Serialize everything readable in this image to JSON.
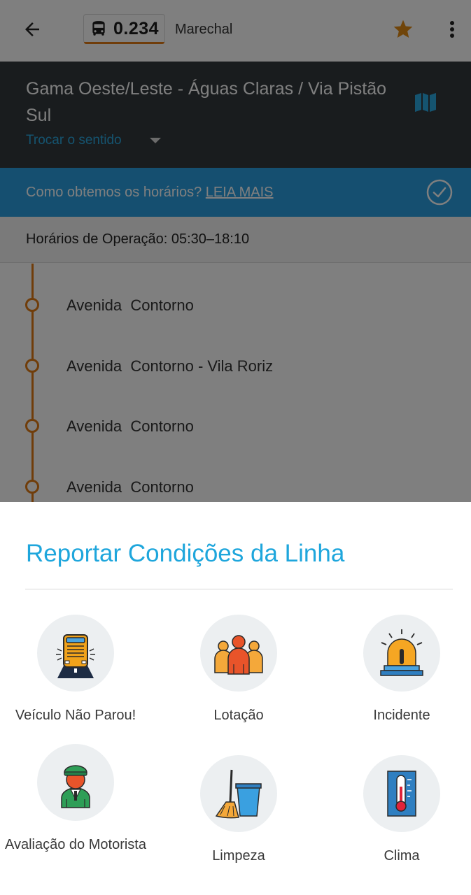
{
  "topbar": {
    "line_number": "0.234",
    "operator": "Marechal",
    "icons": {
      "back": "arrow-left",
      "bus": "bus",
      "favorite": "star",
      "more": "more-vertical"
    },
    "colors": {
      "favorite_star": "#e08a14",
      "line_underline": "#e07b14"
    }
  },
  "route": {
    "title": "Gama Oeste/Leste - Águas Claras / Via Pistão Sul",
    "swap_direction": "Trocar o sentido",
    "icons": {
      "map": "map",
      "caret": "caret-down"
    },
    "colors": {
      "header_bg": "#32383d",
      "link": "#2aa8e0"
    }
  },
  "info_bar": {
    "question": "Como obtemos os horários?",
    "link": "LEIA MAIS",
    "icon": "check-circle",
    "color": "#2a9fe0"
  },
  "operation": {
    "hours_text": "Horários de Operação: 05:30–18:10"
  },
  "stops": [
    {
      "name": "Avenida  Contorno"
    },
    {
      "name": "Avenida  Contorno - Vila Roriz"
    },
    {
      "name": "Avenida  Contorno"
    },
    {
      "name": "Avenida  Contorno"
    }
  ],
  "sheet": {
    "title": "Reportar Condições da Linha",
    "title_color": "#1ea6dc",
    "options": [
      {
        "label": "Veículo Não Parou!",
        "icon": "bus-front-icon"
      },
      {
        "label": "Lotação",
        "icon": "crowd-icon"
      },
      {
        "label": "Incidente",
        "icon": "siren-icon"
      },
      {
        "label": "Avaliação do Motorista",
        "icon": "driver-icon"
      },
      {
        "label": "Limpeza",
        "icon": "broom-bucket-icon"
      },
      {
        "label": "Clima",
        "icon": "thermometer-icon"
      }
    ]
  }
}
